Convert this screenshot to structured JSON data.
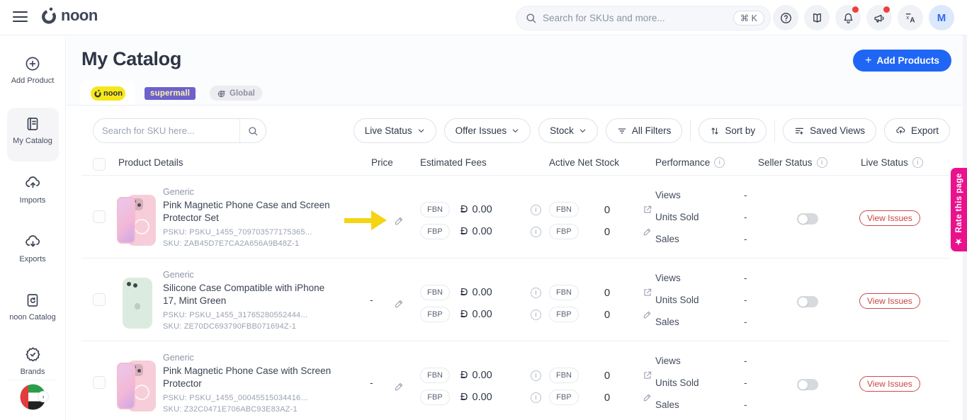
{
  "header": {
    "logo_text": "noon",
    "search_placeholder": "Search for SKUs and more...",
    "shortcut": "⌘ K",
    "avatar_initial": "M"
  },
  "sidebar": {
    "items": [
      {
        "label": "Add Product"
      },
      {
        "label": "My Catalog"
      },
      {
        "label": "Imports"
      },
      {
        "label": "Exports"
      },
      {
        "label": "noon Catalog"
      },
      {
        "label": "Brands"
      }
    ]
  },
  "page": {
    "title": "My Catalog",
    "add_products_label": "Add Products",
    "tabs": [
      {
        "label": "noon"
      },
      {
        "label": "supermall"
      },
      {
        "label": "Global"
      }
    ],
    "rate_this_page": "Rate this page"
  },
  "filters": {
    "sku_search_placeholder": "Search for SKU here...",
    "live_status": "Live Status",
    "offer_issues": "Offer Issues",
    "stock": "Stock",
    "all_filters": "All Filters",
    "sort_by": "Sort by",
    "saved_views": "Saved Views",
    "export": "Export"
  },
  "table": {
    "columns": {
      "product_details": "Product Details",
      "price": "Price",
      "estimated_fees": "Estimated Fees",
      "active_net_stock": "Active Net Stock",
      "performance": "Performance",
      "seller_status": "Seller Status",
      "live_status": "Live Status"
    },
    "fbn": "FBN",
    "fbp": "FBP",
    "currency": "Ð",
    "perf_labels": {
      "views": "Views",
      "units_sold": "Units Sold",
      "sales": "Sales"
    },
    "view_issues": "View Issues"
  },
  "icons": {
    "plus": "+",
    "star": "★",
    "chevron": "›"
  },
  "products": [
    {
      "brand": "Generic",
      "title": "Pink Magnetic Phone Case and Screen Protector Set",
      "psku": "PSKU: PSKU_1455_709703577175365...",
      "sku": "SKU: ZAB45D7E7CA2A656A9B48Z-1",
      "price": "",
      "fee_fbn": "0.00",
      "fee_fbp": "0.00",
      "stock_fbn": "0",
      "stock_fbp": "0",
      "views": "-",
      "units_sold": "-",
      "sales": "-"
    },
    {
      "brand": "Generic",
      "title": "Silicone Case Compatible with iPhone 17, Mint Green",
      "psku": "PSKU: PSKU_1455_31765280552444...",
      "sku": "SKU: ZE70DC693790FBB071694Z-1",
      "price": "-",
      "fee_fbn": "0.00",
      "fee_fbp": "0.00",
      "stock_fbn": "0",
      "stock_fbp": "0",
      "views": "-",
      "units_sold": "-",
      "sales": "-"
    },
    {
      "brand": "Generic",
      "title": "Pink Magnetic Phone Case with Screen Protector",
      "psku": "PSKU: PSKU_1455_00045515034416...",
      "sku": "SKU: Z32C0471E706ABC93E83AZ-1",
      "price": "-",
      "fee_fbn": "0.00",
      "fee_fbp": "0.00",
      "stock_fbn": "0",
      "stock_fbp": "0",
      "views": "-",
      "units_sold": "-",
      "sales": "-"
    }
  ]
}
